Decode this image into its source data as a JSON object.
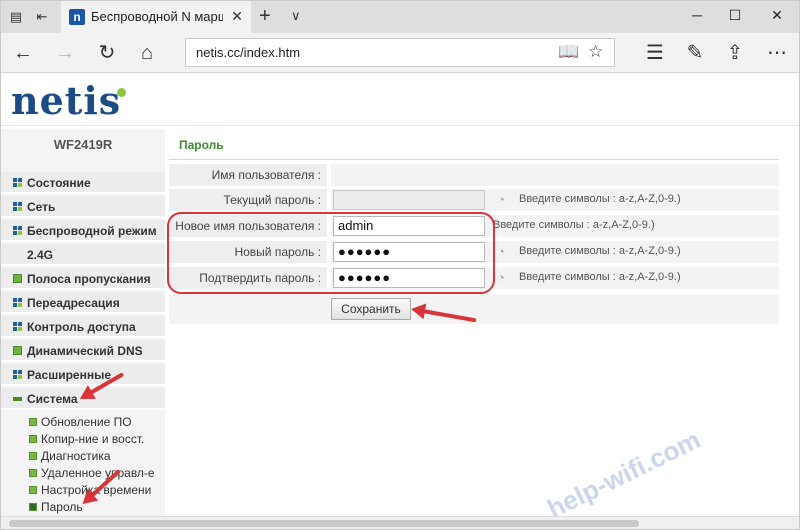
{
  "browser": {
    "tab_title": "Беспроводной N марш",
    "url": "netis.cc/index.htm"
  },
  "brand": {
    "logo_text": "netis"
  },
  "sidebar": {
    "model": "WF2419R",
    "items": [
      {
        "label": "Состояние"
      },
      {
        "label": "Сеть"
      },
      {
        "label": "Беспроводной режим"
      },
      {
        "label": "2.4G"
      },
      {
        "label": "Полоса пропускания"
      },
      {
        "label": "Переадресация"
      },
      {
        "label": "Контроль доступа"
      },
      {
        "label": "Динамический DNS"
      },
      {
        "label": "Расширенные"
      },
      {
        "label": "Система"
      }
    ],
    "sub_items": [
      {
        "label": "Обновление ПО"
      },
      {
        "label": "Копир-ние и восст."
      },
      {
        "label": "Диагностика"
      },
      {
        "label": "Удаленное управл-е"
      },
      {
        "label": "Настройка времени"
      },
      {
        "label": "Пароль"
      }
    ]
  },
  "password_form": {
    "title": "Пароль",
    "username_label": "Имя пользователя :",
    "current_password_label": "Текущий пароль :",
    "new_username_label": "Новое имя пользователя :",
    "new_username_value": "admin",
    "new_password_label": "Новый пароль :",
    "new_password_value": "●●●●●●",
    "confirm_password_label": "Подтвердить пароль :",
    "confirm_password_value": "●●●●●●",
    "hint": "Введите символы : a-z,A-Z,0-9.)",
    "save_label": "Сохранить"
  },
  "watermark": "help-wifi.com",
  "colors": {
    "accent_red": "#d8343a",
    "brand_blue": "#1c4c86",
    "section_green": "#3d8a2c"
  }
}
